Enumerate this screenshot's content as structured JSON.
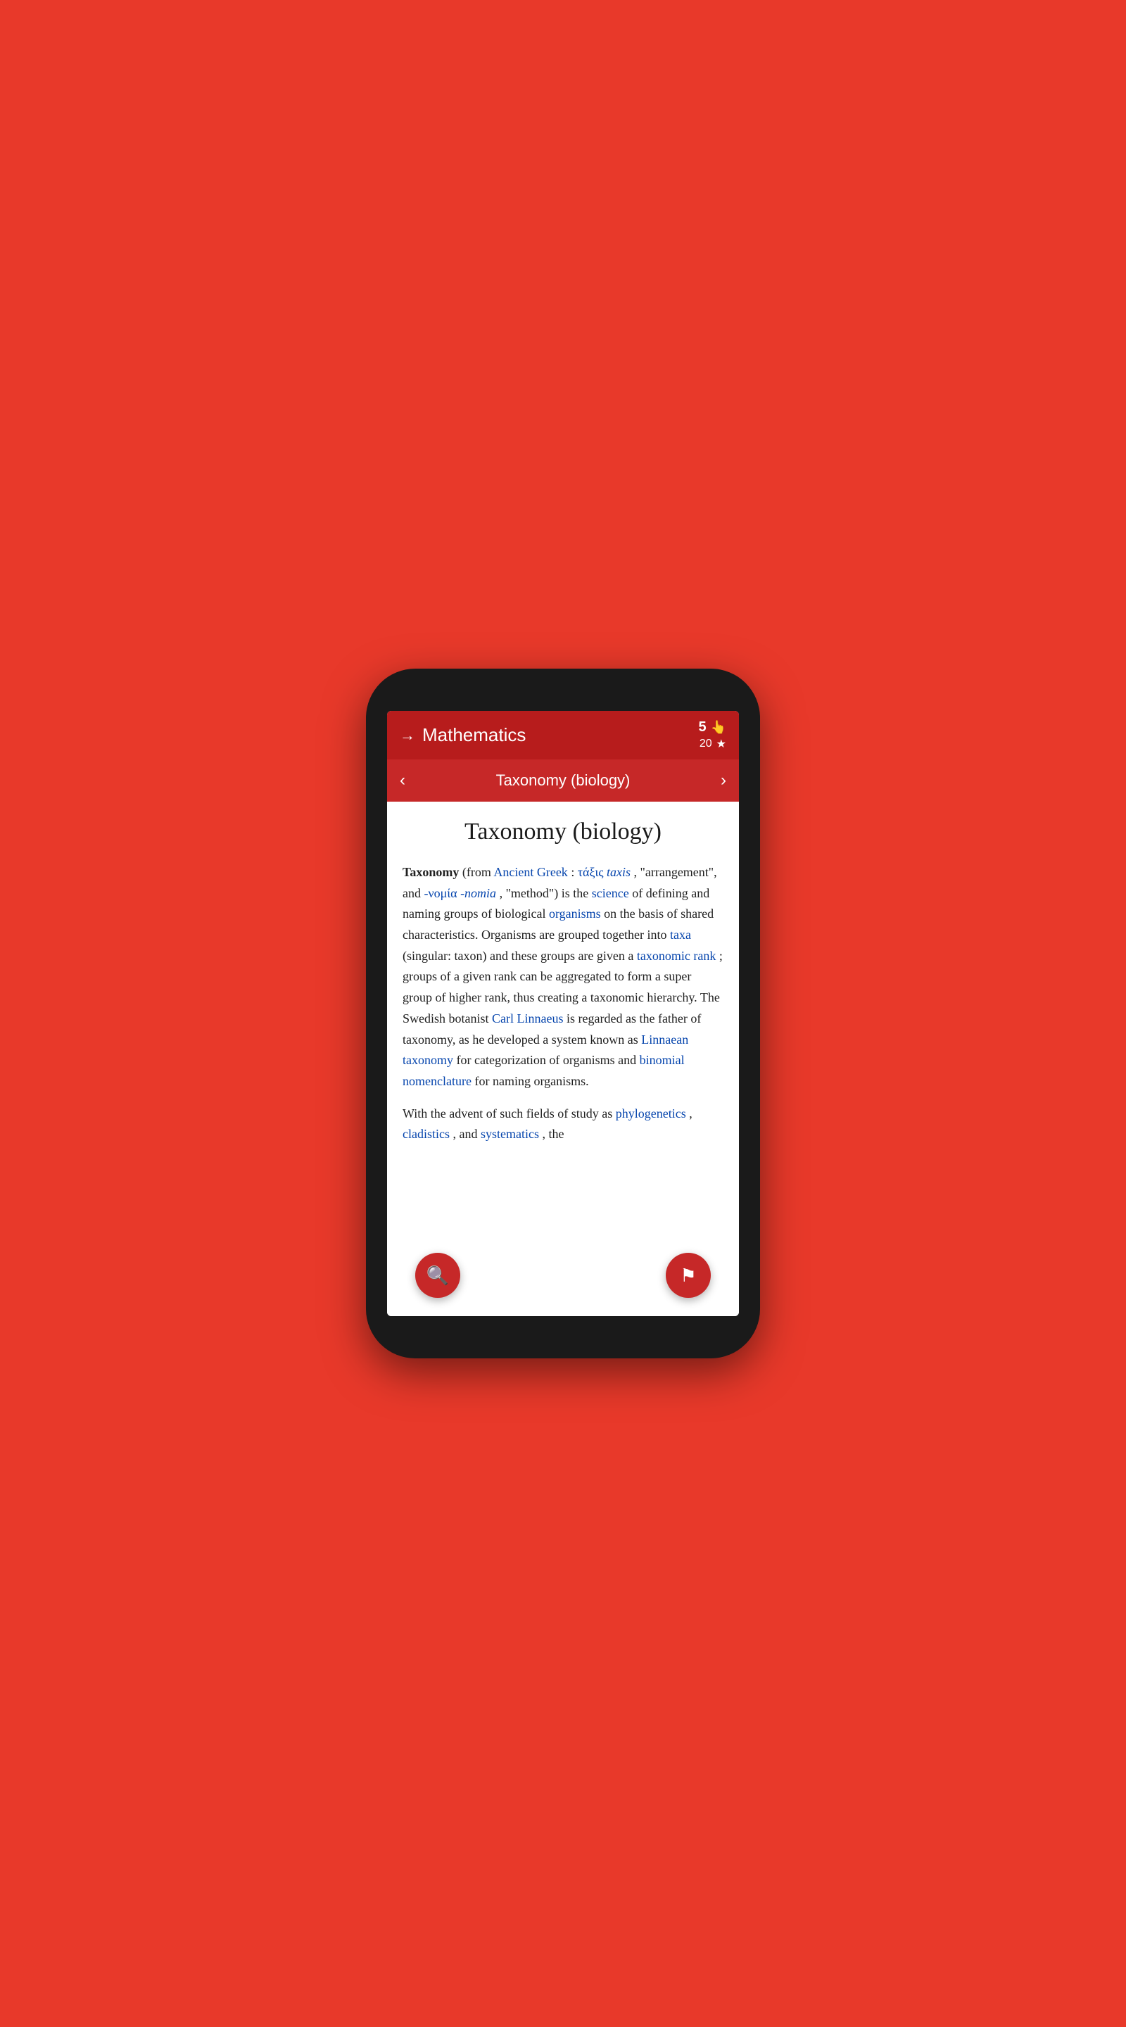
{
  "phone": {
    "top_bar": {
      "arrow": "→",
      "title": "Mathematics",
      "count": "5",
      "count_icon": "👆",
      "sub_count": "20",
      "star": "★"
    },
    "nav_bar": {
      "left_arrow": "‹",
      "title": "Taxonomy (biology)",
      "right_arrow": "›"
    },
    "article": {
      "title": "Taxonomy (biology)",
      "body_intro_bold": "Taxonomy",
      "body_intro_text": " (from ",
      "link_ancient_greek": "Ancient Greek",
      "colon": ": ",
      "link_taxis_greek": "τάξις",
      "link_taxis_latin": " taxis",
      "comma_arrangement": ", \"arrangement\", and ",
      "link_nomia_greek": "-νομία",
      "link_nomia_latin": " -nomia",
      "comma_method": ", \"method\") is the ",
      "link_science": "science",
      "text_defining": " of defining and naming groups of biological ",
      "link_organisms": "organisms",
      "text_basis": " on the basis of shared characteristics. Organisms are grouped together into ",
      "link_taxa": "taxa",
      "text_singular": " (singular: taxon) and these groups are given a ",
      "link_taxonomic_rank": "taxonomic rank",
      "text_groups": "; groups of a given rank can be aggregated to form a super group of higher rank, thus creating a taxonomic hierarchy. The Swedish botanist ",
      "link_carl_linnaeus": "Carl Linnaeus",
      "text_regarded": " is regarded as the father of taxonomy, as he developed a system known as ",
      "link_linnaean": "Linnaean taxonomy",
      "text_categorization": " for categorization of organisms and ",
      "link_binomial": "binomial nomenclature",
      "text_naming": " for naming organisms.",
      "text_advent": "With the advent of such fields of study as ",
      "link_phylogenetics": "phylogenetics",
      "comma2": ", ",
      "link_cladistics": "cladistics",
      "comma3": ", and ",
      "link_systematics": "systematics",
      "text_the": ", the"
    },
    "fab_search_label": "search",
    "fab_flag_label": "flag"
  }
}
